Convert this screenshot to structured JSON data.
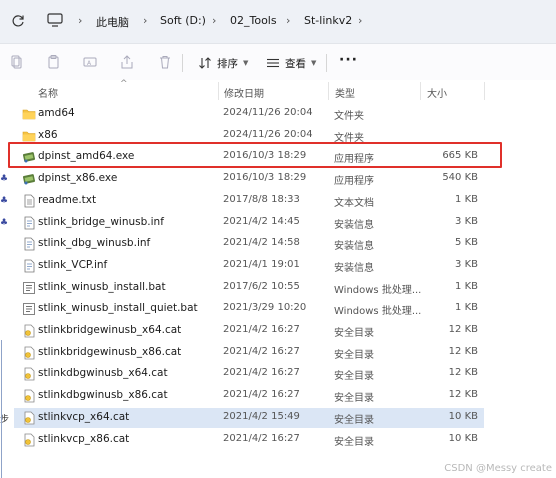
{
  "address_bar": {
    "refresh_icon": "refresh-icon",
    "pc_icon": "monitor-icon",
    "breadcrumbs": [
      "此电脑",
      "Soft (D:)",
      "02_Tools",
      "St-linkv2"
    ],
    "separator": "›"
  },
  "command_bar": {
    "icons": [
      "cut-icon",
      "copy-icon",
      "rename-icon",
      "share-icon",
      "delete-icon"
    ],
    "sort_label": "排序",
    "view_label": "查看",
    "more_label": "···"
  },
  "columns": {
    "name": "名称",
    "date": "修改日期",
    "type": "类型",
    "size": "大小"
  },
  "files": [
    {
      "name": "amd64",
      "date": "2024/11/26 20:04",
      "type": "文件夹",
      "size": "",
      "icon": "folder-icon"
    },
    {
      "name": "x86",
      "date": "2024/11/26 20:04",
      "type": "文件夹",
      "size": "",
      "icon": "folder-icon"
    },
    {
      "name": "dpinst_amd64.exe",
      "date": "2016/10/3 18:29",
      "type": "应用程序",
      "size": "665 KB",
      "icon": "exe-icon"
    },
    {
      "name": "dpinst_x86.exe",
      "date": "2016/10/3 18:29",
      "type": "应用程序",
      "size": "540 KB",
      "icon": "exe-icon"
    },
    {
      "name": "readme.txt",
      "date": "2017/8/8 18:33",
      "type": "文本文档",
      "size": "1 KB",
      "icon": "text-file-icon"
    },
    {
      "name": "stlink_bridge_winusb.inf",
      "date": "2021/4/2 14:45",
      "type": "安装信息",
      "size": "3 KB",
      "icon": "inf-file-icon"
    },
    {
      "name": "stlink_dbg_winusb.inf",
      "date": "2021/4/2 14:58",
      "type": "安装信息",
      "size": "5 KB",
      "icon": "inf-file-icon"
    },
    {
      "name": "stlink_VCP.inf",
      "date": "2021/4/1 19:01",
      "type": "安装信息",
      "size": "3 KB",
      "icon": "inf-file-icon"
    },
    {
      "name": "stlink_winusb_install.bat",
      "date": "2017/6/2 10:55",
      "type": "Windows 批处理...",
      "size": "1 KB",
      "icon": "bat-file-icon"
    },
    {
      "name": "stlink_winusb_install_quiet.bat",
      "date": "2021/3/29 10:20",
      "type": "Windows 批处理...",
      "size": "1 KB",
      "icon": "bat-file-icon"
    },
    {
      "name": "stlinkbridgewinusb_x64.cat",
      "date": "2021/4/2 16:27",
      "type": "安全目录",
      "size": "12 KB",
      "icon": "cat-file-icon"
    },
    {
      "name": "stlinkbridgewinusb_x86.cat",
      "date": "2021/4/2 16:27",
      "type": "安全目录",
      "size": "12 KB",
      "icon": "cat-file-icon"
    },
    {
      "name": "stlinkdbgwinusb_x64.cat",
      "date": "2021/4/2 16:27",
      "type": "安全目录",
      "size": "12 KB",
      "icon": "cat-file-icon"
    },
    {
      "name": "stlinkdbgwinusb_x86.cat",
      "date": "2021/4/2 16:27",
      "type": "安全目录",
      "size": "12 KB",
      "icon": "cat-file-icon"
    },
    {
      "name": "stlinkvcp_x64.cat",
      "date": "2021/4/2 15:49",
      "type": "安全目录",
      "size": "10 KB",
      "icon": "cat-file-icon"
    },
    {
      "name": "stlinkvcp_x86.cat",
      "date": "2021/4/2 16:27",
      "type": "安全目录",
      "size": "10 KB",
      "icon": "cat-file-icon"
    }
  ],
  "selected_index": 14,
  "highlighted_index": 2,
  "highlight_color": "#e0302a",
  "left_edge_glyphs": [
    "♣",
    "♣",
    "♣",
    "步"
  ],
  "watermark": "CSDN @Messy create"
}
